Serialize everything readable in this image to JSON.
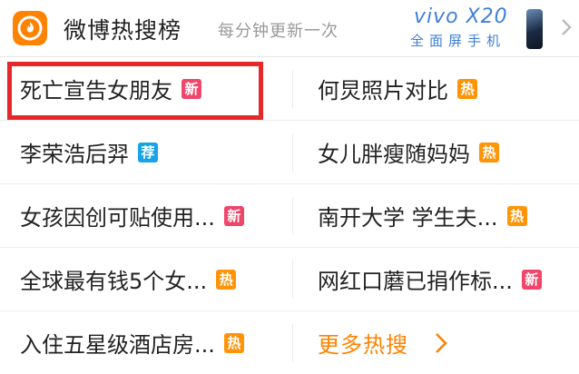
{
  "header": {
    "title": "微博热搜榜",
    "subtitle": "每分钟更新一次",
    "ad": {
      "brand": "vivo X20",
      "tagline": "全面屏手机"
    }
  },
  "rows": [
    {
      "left": {
        "text": "死亡宣告女朋友",
        "tag": "新",
        "tag_type": "new"
      },
      "right": {
        "text": "何炅照片对比",
        "tag": "热",
        "tag_type": "hot"
      }
    },
    {
      "left": {
        "text": "李荣浩后羿",
        "tag": "荐",
        "tag_type": "rec"
      },
      "right": {
        "text": "女儿胖瘦随妈妈",
        "tag": "热",
        "tag_type": "hot"
      }
    },
    {
      "left": {
        "text": "女孩因创可贴使用...",
        "tag": "新",
        "tag_type": "new"
      },
      "right": {
        "text": "南开大学 学生夫...",
        "tag": "热",
        "tag_type": "hot"
      }
    },
    {
      "left": {
        "text": "全球最有钱5个女...",
        "tag": "热",
        "tag_type": "hot"
      },
      "right": {
        "text": "网红口蘑已捐作标...",
        "tag": "新",
        "tag_type": "new"
      }
    },
    {
      "left": {
        "text": "入住五星级酒店房...",
        "tag": "热",
        "tag_type": "hot"
      },
      "right": {
        "more": "更多热搜"
      }
    }
  ],
  "colors": {
    "accent": "#ff8200",
    "new": "#f0466b",
    "hot": "#ff9406",
    "rec": "#17a4e6",
    "highlight": "#e6282b"
  }
}
